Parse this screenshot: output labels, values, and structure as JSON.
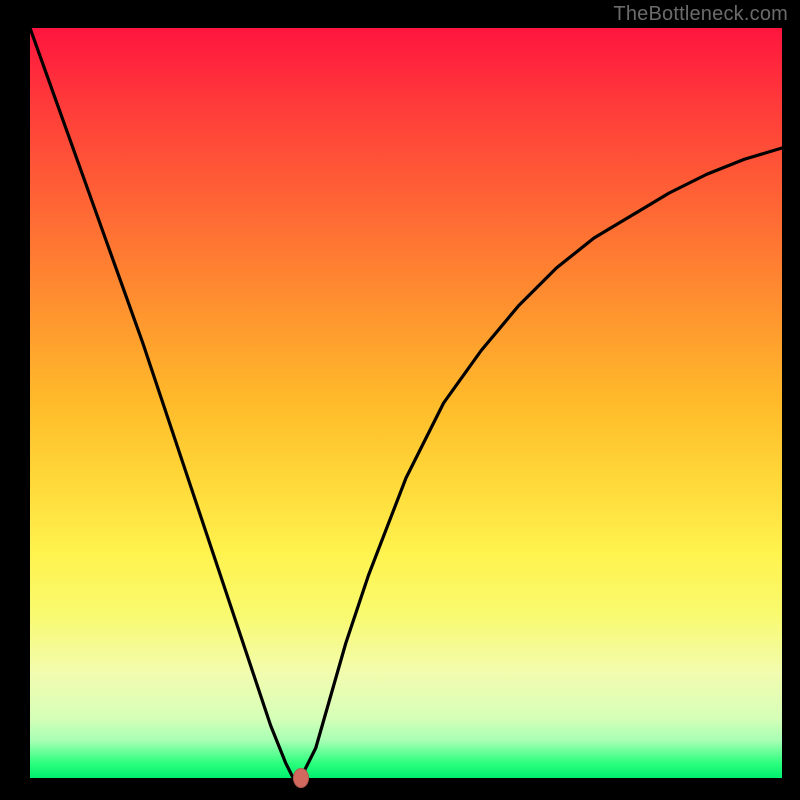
{
  "watermark": "TheBottleneck.com",
  "colors": {
    "background": "#000000",
    "curve_stroke": "#000000",
    "marker_fill": "#d2695e",
    "gradient_top": "#ff153e",
    "gradient_bottom": "#00f06e"
  },
  "chart_data": {
    "type": "line",
    "title": "",
    "xlabel": "",
    "ylabel": "",
    "xlim": [
      0,
      100
    ],
    "ylim": [
      0,
      100
    ],
    "grid": false,
    "x": [
      0,
      5,
      10,
      15,
      20,
      25,
      28,
      30,
      32,
      34,
      35,
      36,
      38,
      40,
      42,
      45,
      50,
      55,
      60,
      65,
      70,
      75,
      80,
      85,
      90,
      95,
      100
    ],
    "y": [
      100,
      86,
      72,
      58,
      43,
      28,
      19,
      13,
      7,
      2,
      0,
      0,
      4,
      11,
      18,
      27,
      40,
      50,
      57,
      63,
      68,
      72,
      75,
      78,
      80.5,
      82.5,
      84
    ],
    "marker": {
      "x": 36,
      "y": 0
    },
    "annotations": []
  }
}
